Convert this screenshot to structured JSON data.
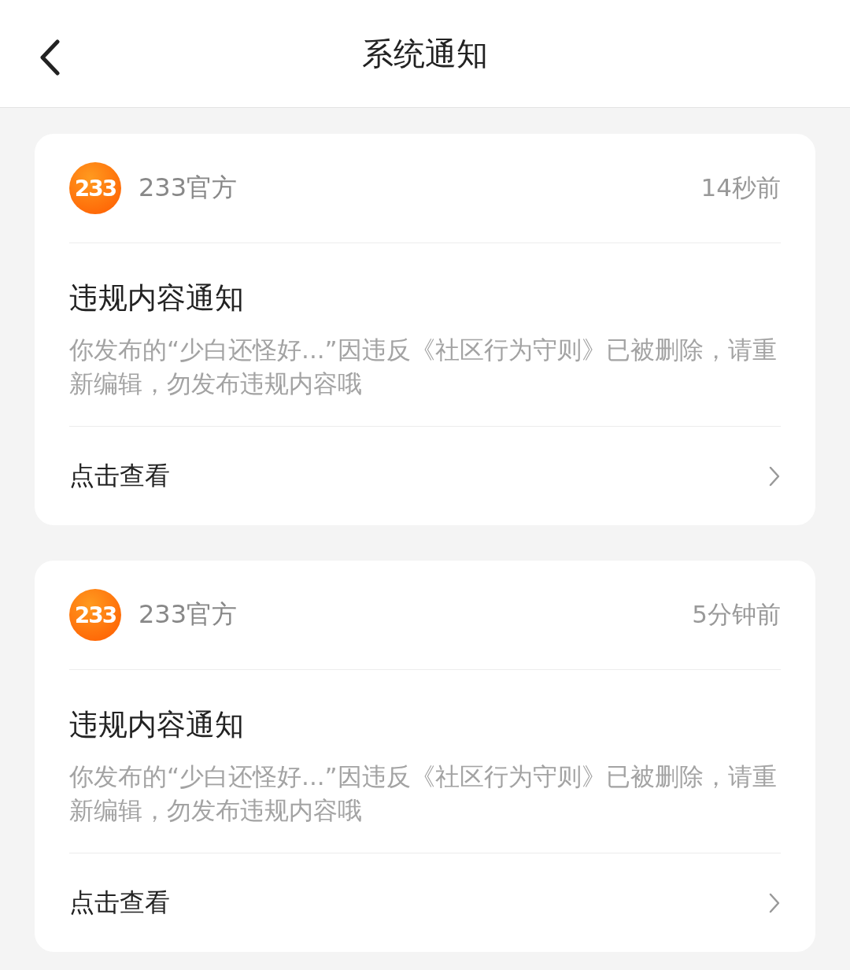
{
  "header": {
    "title": "系统通知"
  },
  "notifications": [
    {
      "logo_text": "233",
      "sender": "233官方",
      "time": "14秒前",
      "title": "违规内容通知",
      "body": "你发布的“少白还怪好...”因违反《社区行为守则》已被删除，请重新编辑，勿发布违规内容哦",
      "action": "点击查看"
    },
    {
      "logo_text": "233",
      "sender": "233官方",
      "time": "5分钟前",
      "title": "违规内容通知",
      "body": "你发布的“少白还怪好...”因违反《社区行为守则》已被删除，请重新编辑，勿发布违规内容哦",
      "action": "点击查看"
    }
  ]
}
